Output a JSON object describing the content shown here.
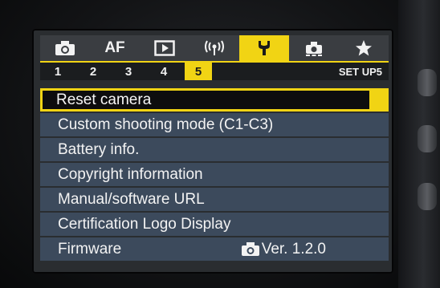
{
  "tabs": [
    {
      "label": "",
      "icon": "camera-icon",
      "active": false
    },
    {
      "label": "AF",
      "icon": "",
      "active": false
    },
    {
      "label": "",
      "icon": "playback-icon",
      "active": false
    },
    {
      "label": "",
      "icon": "wireless-icon",
      "active": false
    },
    {
      "label": "",
      "icon": "wrench-icon",
      "active": true
    },
    {
      "label": "",
      "icon": "custom-settings-icon",
      "active": false
    },
    {
      "label": "",
      "icon": "star-icon",
      "active": false
    }
  ],
  "pages": [
    "1",
    "2",
    "3",
    "4",
    "5"
  ],
  "active_page": "5",
  "page_group": "SET UP5",
  "menu": {
    "items": [
      {
        "label": "Reset camera",
        "selected": true
      },
      {
        "label": "Custom shooting mode (C1-C3)"
      },
      {
        "label": "Battery info."
      },
      {
        "label": "Copyright information"
      },
      {
        "label": "Manual/software URL"
      },
      {
        "label": "Certification Logo Display"
      },
      {
        "label": "Firmware",
        "value": "Ver. 1.2.0",
        "value_icon": "camera-icon"
      }
    ]
  },
  "colors": {
    "accent": "#f1d414",
    "item_bg": "#3c4a5c",
    "tab_bg": "#3a3d41"
  }
}
